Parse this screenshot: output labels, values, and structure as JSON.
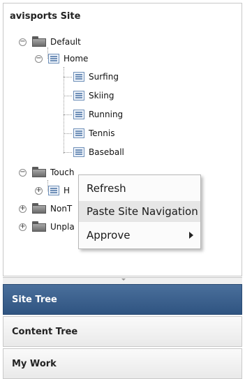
{
  "site": {
    "title": "avisports Site"
  },
  "tree": {
    "default": {
      "label": "Default",
      "toggle": "−"
    },
    "home": {
      "label": "Home",
      "toggle": "−"
    },
    "children": [
      {
        "label": "Surfing"
      },
      {
        "label": "Skiing"
      },
      {
        "label": "Running"
      },
      {
        "label": "Tennis"
      },
      {
        "label": "Baseball"
      }
    ],
    "touch": {
      "label": "Touch",
      "toggle": "−"
    },
    "touch_child": {
      "label": "H",
      "toggle": "+"
    },
    "nont": {
      "label": "NonT",
      "toggle": "+"
    },
    "unpl": {
      "label": "Unpla",
      "toggle": "+"
    }
  },
  "context_menu": {
    "items": [
      {
        "label": "Refresh"
      },
      {
        "label": "Paste Site Navigation"
      },
      {
        "label": "Approve"
      }
    ]
  },
  "accordion": {
    "site_tree": "Site Tree",
    "content_tree": "Content Tree",
    "my_work": "My Work"
  },
  "colors": {
    "active_tab": "#3b6190",
    "menu_highlight": "#e6e6e6",
    "tree_line": "#9a9a9a"
  },
  "icons": {
    "folder": "folder-icon",
    "page": "page-icon",
    "submenu": "submenu-arrow-icon"
  }
}
